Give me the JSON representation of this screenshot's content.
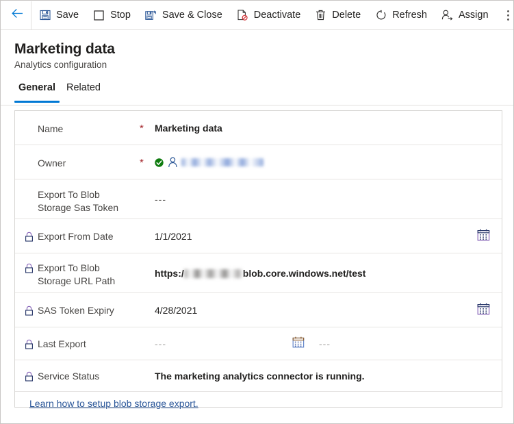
{
  "commandbar": {
    "back_icon": "back-arrow-icon",
    "overflow_icon": "overflow-menu-icon",
    "buttons": [
      {
        "label": "Save",
        "icon": "save-icon"
      },
      {
        "label": "Stop",
        "icon": "stop-icon"
      },
      {
        "label": "Save & Close",
        "icon": "save-and-close-icon"
      },
      {
        "label": "Deactivate",
        "icon": "deactivate-icon"
      },
      {
        "label": "Delete",
        "icon": "delete-icon"
      },
      {
        "label": "Refresh",
        "icon": "refresh-icon"
      },
      {
        "label": "Assign",
        "icon": "assign-icon"
      }
    ]
  },
  "header": {
    "title": "Marketing data",
    "subtitle": "Analytics configuration"
  },
  "tabs": [
    {
      "label": "General",
      "active": true
    },
    {
      "label": "Related",
      "active": false
    }
  ],
  "form": {
    "required_marker": "*",
    "rows": [
      {
        "label": "Name",
        "value": "Marketing data",
        "required": true,
        "locked": false
      },
      {
        "label": "Owner",
        "value": "",
        "required": true,
        "locked": false
      },
      {
        "label_line1": "Export To Blob",
        "label_line2": "Storage Sas Token",
        "value": "---",
        "required": false,
        "locked": false
      },
      {
        "label": "Export From Date",
        "value": "1/1/2021",
        "required": false,
        "locked": true
      },
      {
        "label_line1": "Export To Blob",
        "label_line2": "Storage URL Path",
        "value_prefix": "https:/",
        "value_suffix": "blob.core.windows.net/test",
        "required": false,
        "locked": true
      },
      {
        "label": "SAS Token Expiry",
        "value": "4/28/2021",
        "required": false,
        "locked": true
      },
      {
        "label": "Last Export",
        "value": "---",
        "value2": "---",
        "required": false,
        "locked": true
      },
      {
        "label": "Service Status",
        "value": "The marketing analytics connector is running.",
        "required": false,
        "locked": true
      }
    ]
  },
  "footer": {
    "link_label": "Learn how to setup blob storage export."
  },
  "colors": {
    "accent": "#0078d4",
    "required": "#a4262c",
    "link": "#2b579a",
    "validated": "#107c10",
    "lock_shackle": "#8764b8",
    "lock_body": "#2b3a6b",
    "calendar_purple": "#8764b8",
    "calendar_blue": "#3b5ba5",
    "text_primary": "#201f1e",
    "text_secondary": "#484644",
    "border": "#e1dfdd"
  },
  "icons": {
    "calendar": "calendar-icon",
    "lock": "lock-icon",
    "validated_check": "validated-check-icon",
    "person": "person-icon"
  }
}
